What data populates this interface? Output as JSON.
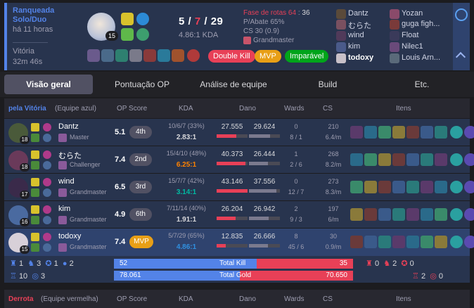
{
  "match": {
    "queue": "Ranqueada Solo/Duo",
    "time_ago": "há 11 horas",
    "result": "Vitória",
    "duration": "32m 46s"
  },
  "me": {
    "level": "15",
    "kills": "5",
    "deaths": "7",
    "assists": "29",
    "kda_ratio": "4.86:1 KDA",
    "stage_label": "Fase de rotas 64",
    "stage_value": "36",
    "kill_participation": "P/Abate 65%",
    "cs": "CS 30 (0.9)",
    "tier": "Grandmaster",
    "badges": [
      "Double Kill",
      "MVP",
      "Imparável"
    ]
  },
  "team_list_blue": [
    "Dantz",
    "むらた",
    "wind",
    "kim",
    "todoxy"
  ],
  "team_list_red": [
    "Yozan",
    "guga figh...",
    "Float",
    "Nilec1",
    "Louis Arn..."
  ],
  "tabs": [
    "Visão geral",
    "Pontuação OP",
    "Análise de equipe",
    "Build",
    "Etc."
  ],
  "blue_header": {
    "team": "pela Vitória",
    "side": "(Equipe azul)",
    "op": "OP Score",
    "kda": "KDA",
    "dmg": "Dano",
    "wards": "Wards",
    "cs": "CS",
    "items": "Itens"
  },
  "blue_players": [
    {
      "name": "Dantz",
      "tier": "Master",
      "level": "18",
      "op": "5.1",
      "rank": "4th",
      "kda": "10/6/7 (33%)",
      "ratio": "2.83:1",
      "ratio_color": "#d9d9dc",
      "dealt": "27.555",
      "taken": "29.624",
      "dealt_pct": 0.64,
      "taken_pct": 0.69,
      "wards": "0",
      "wards2": "8 / 1",
      "cs": "210",
      "csm": "6.4/m"
    },
    {
      "name": "むらた",
      "tier": "Challenger",
      "level": "18",
      "op": "7.4",
      "rank": "2nd",
      "kda": "15/4/10 (48%)",
      "ratio": "6.25:1",
      "ratio_color": "#ff8200",
      "dealt": "40.373",
      "taken": "26.444",
      "dealt_pct": 0.94,
      "taken_pct": 0.62,
      "wards": "1",
      "wards2": "2 / 6",
      "cs": "268",
      "csm": "8.2/m"
    },
    {
      "name": "wind",
      "tier": "Grandmaster",
      "level": "17",
      "op": "6.5",
      "rank": "3rd",
      "kda": "15/7/7 (42%)",
      "ratio": "3.14:1",
      "ratio_color": "#00bba3",
      "dealt": "43.146",
      "taken": "37.556",
      "dealt_pct": 1.0,
      "taken_pct": 0.88,
      "wards": "0",
      "wards2": "12 / 7",
      "cs": "273",
      "csm": "8.3/m"
    },
    {
      "name": "kim",
      "tier": "Grandmaster",
      "level": "16",
      "op": "4.9",
      "rank": "6th",
      "kda": "7/11/14 (40%)",
      "ratio": "1.91:1",
      "ratio_color": "#d9d9dc",
      "dealt": "26.204",
      "taken": "26.942",
      "dealt_pct": 0.61,
      "taken_pct": 0.63,
      "wards": "2",
      "wards2": "9 / 3",
      "cs": "197",
      "csm": "6/m"
    },
    {
      "name": "todoxy",
      "tier": "Grandmaster",
      "level": "15",
      "op": "7.4",
      "rank": "MVP",
      "kda": "5/7/29 (65%)",
      "ratio": "4.86:1",
      "ratio_color": "#3090e0",
      "dealt": "12.835",
      "taken": "26.666",
      "dealt_pct": 0.3,
      "taken_pct": 0.62,
      "wards": "8",
      "wards2": "45 / 6",
      "cs": "30",
      "csm": "0.9/m"
    }
  ],
  "summary": {
    "blue_obj": [
      "1",
      "3",
      "1",
      "2",
      "10",
      "3"
    ],
    "red_obj": [
      "0",
      "2",
      "0",
      "2",
      "0"
    ],
    "kill_blue": "52",
    "kill_red": "35",
    "kill_label": "Total Kill",
    "kill_pct": 0.598,
    "gold_blue": "78.061",
    "gold_red": "70.650",
    "gold_label": "Total Gold",
    "gold_pct": 0.525
  },
  "red_header": {
    "team": "Derrota",
    "side": "(Equipe vermelha)",
    "op": "OP Score",
    "kda": "KDA",
    "dmg": "Dano",
    "wards": "Wards",
    "cs": "CS",
    "items": "Itens"
  },
  "colors": {
    "blue": "#5383e8",
    "red": "#e84057",
    "win_bg": "#28344e",
    "accent_gold": "#e89f16"
  }
}
